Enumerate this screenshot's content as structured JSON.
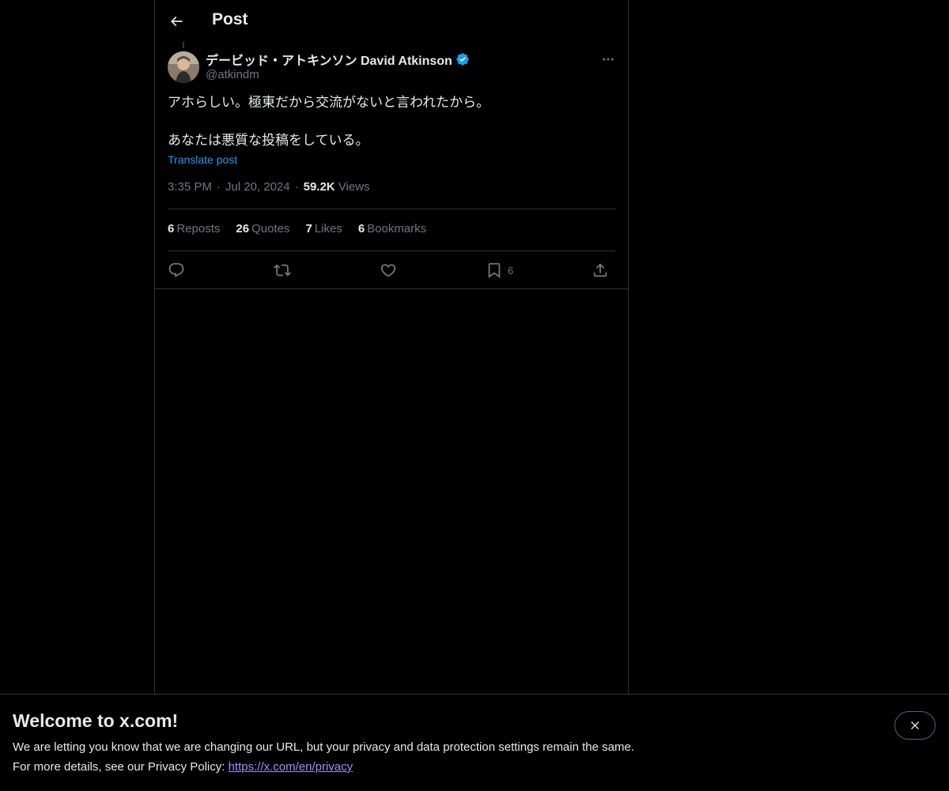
{
  "header": {
    "title": "Post"
  },
  "author": {
    "display_name": "デービッド・アトキンソン David Atkinson",
    "handle": "@atkindm",
    "verified": true
  },
  "post": {
    "line1": "アホらしい。極東だから交流がないと言われたから。",
    "line2": "あなたは悪質な投稿をしている。",
    "translate_label": "Translate post",
    "time": "3:35 PM",
    "date": "Jul 20, 2024",
    "views_count": "59.2K",
    "views_label": "Views",
    "separator": "·"
  },
  "stats": [
    {
      "count": "6",
      "label": "Reposts"
    },
    {
      "count": "26",
      "label": "Quotes"
    },
    {
      "count": "7",
      "label": "Likes"
    },
    {
      "count": "6",
      "label": "Bookmarks"
    }
  ],
  "actions": {
    "bookmark_count": "6"
  },
  "banner": {
    "title": "Welcome to x.com!",
    "line1": "We are letting you know that we are changing our URL, but your privacy and data protection settings remain the same.",
    "line2_prefix": "For more details, see our Privacy Policy: ",
    "link": "https://x.com/en/privacy"
  },
  "colors": {
    "background": "#000000",
    "text": "#e7e9ea",
    "muted": "#71767b",
    "accent": "#1d9bf0",
    "link_visited": "#a78bfa",
    "border": "#2f3336"
  },
  "icons": [
    "back-arrow-icon",
    "verified-badge-icon",
    "more-icon",
    "reply-icon",
    "repost-icon",
    "like-icon",
    "bookmark-icon",
    "share-icon",
    "close-icon"
  ]
}
